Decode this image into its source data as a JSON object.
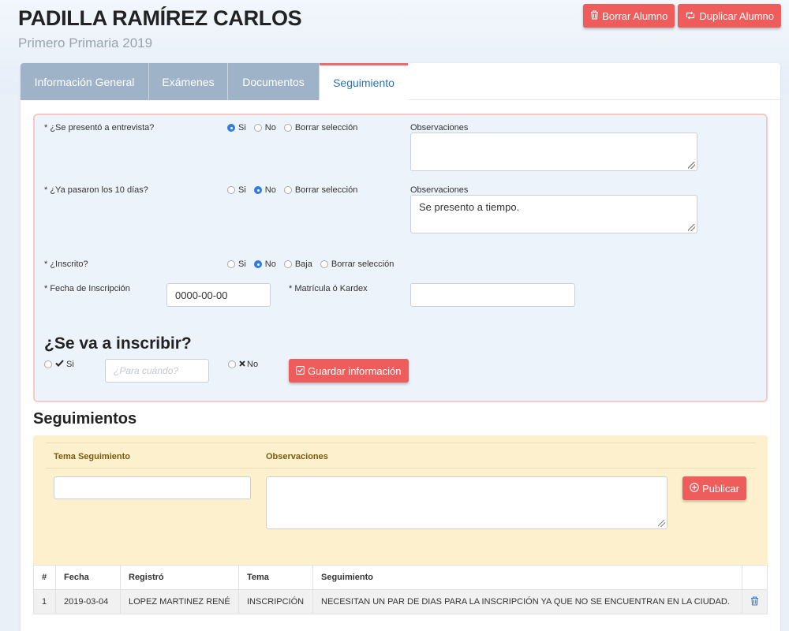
{
  "student": {
    "name": "PADILLA RAMÍREZ CARLOS",
    "grade": "Primero Primaria 2019"
  },
  "actions": {
    "delete_label": "Borrar Alumno",
    "duplicate_label": "Duplicar Alumno"
  },
  "tabs": [
    {
      "label": "Información General",
      "active": false
    },
    {
      "label": "Exámenes",
      "active": false
    },
    {
      "label": "Documentos",
      "active": false
    },
    {
      "label": "Seguimiento",
      "active": true
    }
  ],
  "form": {
    "q1": {
      "label": "* ¿Se presentó a entrevista?",
      "options": [
        "Si",
        "No",
        "Borrar selección"
      ],
      "selected": "Si"
    },
    "q1_obs_label": "Observaciones",
    "q1_obs_value": "",
    "q2": {
      "label": "* ¿Ya pasaron los 10 días?",
      "options": [
        "Si",
        "No",
        "Borrar selección"
      ],
      "selected": "No"
    },
    "q2_obs_label": "Observaciones",
    "q2_obs_value": "Se presento a tiempo.",
    "q3": {
      "label": "* ¿Inscrito?",
      "options": [
        "Si",
        "No",
        "Baja",
        "Borrar selección"
      ],
      "selected": "No"
    },
    "fecha_label": "* Fecha de Inscripción",
    "fecha_value": "0000-00-00",
    "matricula_label": "* Matrícula ó Kardex",
    "matricula_value": "",
    "inscribir_title": "¿Se va a inscribir?",
    "inscribir_si": "Si",
    "inscribir_no": "No",
    "para_cuando_placeholder": "¿Para cuándo?",
    "save_label": "Guardar información"
  },
  "seguimientos": {
    "title": "Seguimientos",
    "tema_header": "Tema Seguimiento",
    "obs_header": "Observaciones",
    "publish_label": "Publicar"
  },
  "table": {
    "headers": [
      "#",
      "Fecha",
      "Registró",
      "Tema",
      "Seguimiento"
    ],
    "rows": [
      [
        "1",
        "2019-03-04",
        "LOPEZ MARTINEZ RENÉ",
        "INSCRIPCIÓN",
        "NECESITAN UN PAR DE DIAS PARA LA INSCRIPCIÓN YA QUE NO SE ENCUENTRAN EN LA CIUDAD."
      ]
    ]
  }
}
